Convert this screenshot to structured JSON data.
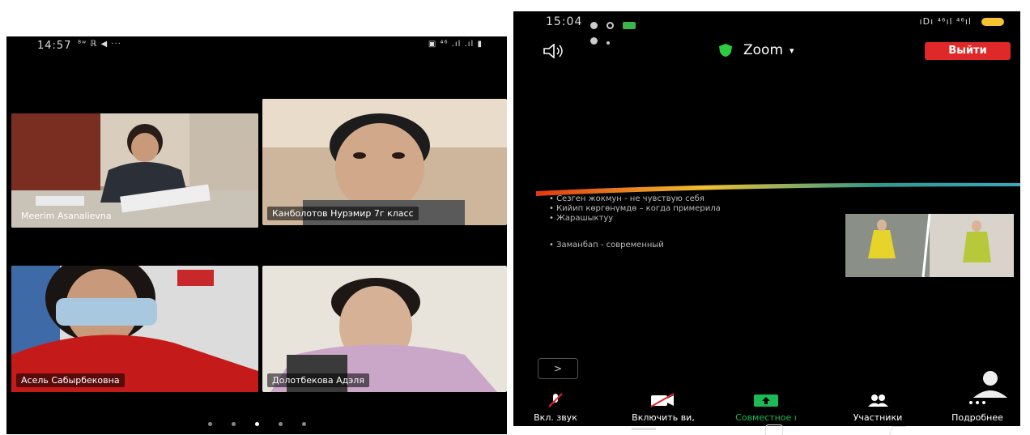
{
  "left_phone": {
    "status_time": "14:57",
    "status_extra": "⁸ʷ  ℝ  ◀  ···",
    "status_right": "▣ ⁴⁶ .ıl .ıl ▮",
    "participants": [
      {
        "name": "Meerim Asanalievna"
      },
      {
        "name": "Канболотов Нурэмир 7г класс"
      },
      {
        "name": "Асель Сабырбековна"
      },
      {
        "name": "Долотбекова Адэля"
      }
    ],
    "page_dots": 5,
    "active_dot": 2
  },
  "right_phone": {
    "status_time": "15:04",
    "status_right": "ıDı ⁴⁶ıl ⁴⁶ıl",
    "app_title": "Zoom",
    "leave_label": "Выйти",
    "slide_bullets": [
      "• Сезген жокмун  -  не чувствую себя",
      "• Кийип көргөнүмдө – когда примерила",
      "• Жарашыктуу",
      "• Заманбап - современный"
    ],
    "toolbar": [
      {
        "label": "Вкл. звук",
        "icon": "muted-mic-icon"
      },
      {
        "label": "Включить ви,",
        "icon": "video-off-icon"
      },
      {
        "label": "Совместное ı",
        "icon": "share-screen-icon"
      },
      {
        "label": "Участники",
        "icon": "participants-icon"
      },
      {
        "label": "Подробнее",
        "icon": "more-icon"
      }
    ],
    "colors": {
      "leave": "#e02828",
      "share": "#1db954",
      "shield": "#2ecc40"
    }
  }
}
